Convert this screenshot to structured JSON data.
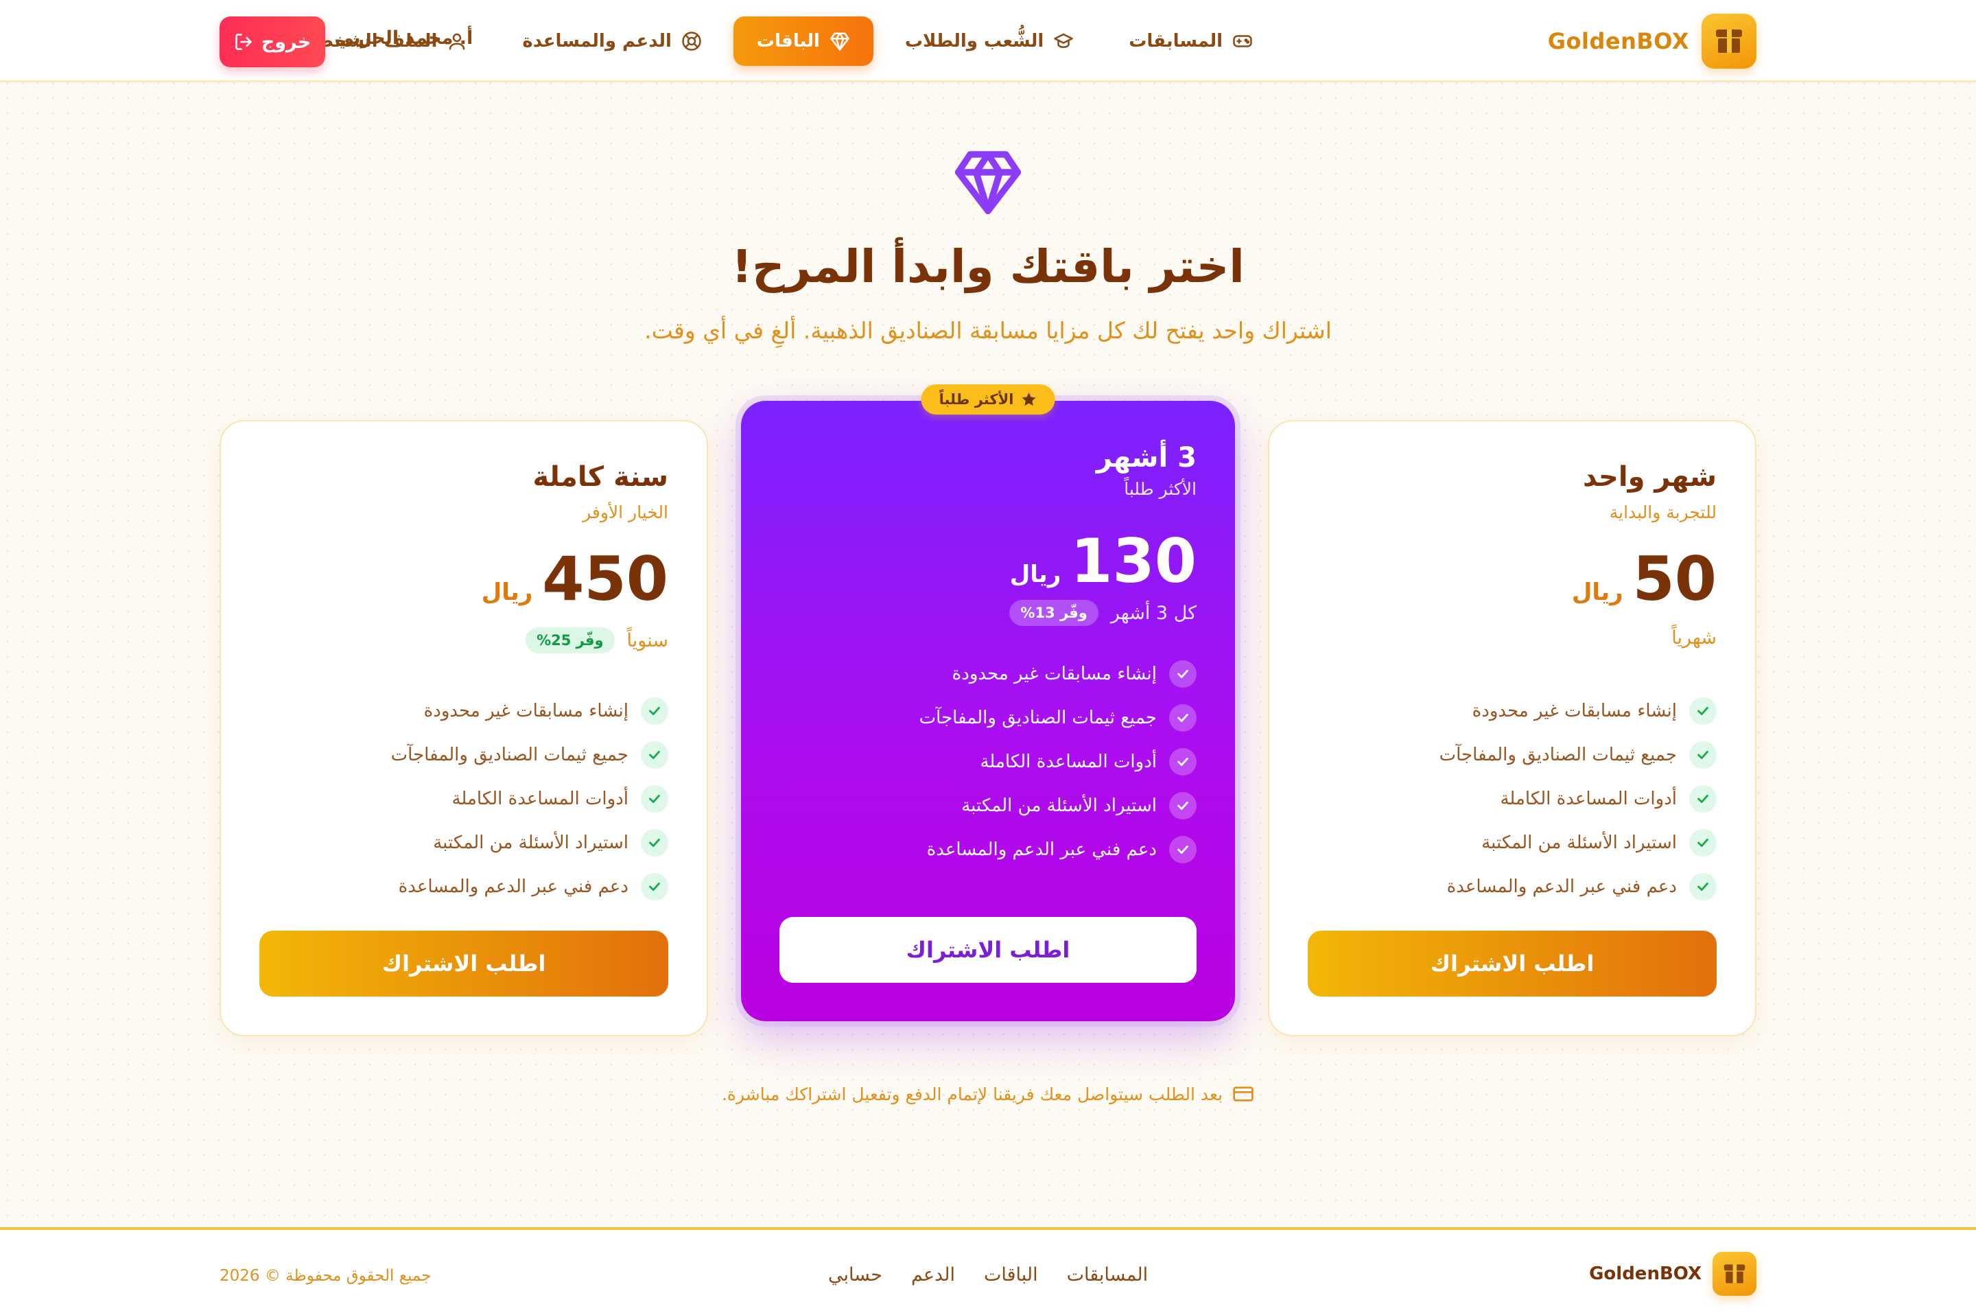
{
  "nav": {
    "brand": "GoldenBOX",
    "items": [
      {
        "label": "المسابقات",
        "icon": "gamepad-icon"
      },
      {
        "label": "الشُّعب والطلاب",
        "icon": "graduation-cap-icon"
      },
      {
        "label": "الباقات",
        "icon": "diamond-icon"
      },
      {
        "label": "الدعم والمساعدة",
        "icon": "lifebuoy-icon"
      },
      {
        "label": "الملف الشخصي",
        "icon": "user-icon"
      }
    ],
    "active_item": "الباقات",
    "user_name": "أ. محمد الحربي",
    "logout_label": "خروج"
  },
  "hero": {
    "icon": "diamond-icon",
    "title": "اختر باقتك وابدأ المرح!",
    "subtitle": "اشتراك واحد يفتح لك كل مزايا مسابقة الصناديق الذهبية. ألغِ في أي وقت."
  },
  "plans": [
    {
      "name": "شهر واحد",
      "tagline": "للتجربة والبداية",
      "price": "50",
      "currency": "ريال",
      "period": "شهرياً",
      "features": [
        "إنشاء مسابقات غير محدودة",
        "جميع ثيمات الصناديق والمفاجآت",
        "أدوات المساعدة الكاملة",
        "استيراد الأسئلة من المكتبة",
        "دعم فني عبر الدعم والمساعدة"
      ],
      "cta": "اطلب الاشتراك"
    },
    {
      "name": "3 أشهر",
      "tagline": "الأكثر طلباً",
      "price": "130",
      "currency": "ريال",
      "period": "كل 3 أشهر",
      "save": "وفّر 13%",
      "badge": "الأكثر طلباً",
      "features": [
        "إنشاء مسابقات غير محدودة",
        "جميع ثيمات الصناديق والمفاجآت",
        "أدوات المساعدة الكاملة",
        "استيراد الأسئلة من المكتبة",
        "دعم فني عبر الدعم والمساعدة"
      ],
      "cta": "اطلب الاشتراك"
    },
    {
      "name": "سنة كاملة",
      "tagline": "الخيار الأوفر",
      "price": "450",
      "currency": "ريال",
      "period": "سنوياً",
      "save": "وفّر 25%",
      "features": [
        "إنشاء مسابقات غير محدودة",
        "جميع ثيمات الصناديق والمفاجآت",
        "أدوات المساعدة الكاملة",
        "استيراد الأسئلة من المكتبة",
        "دعم فني عبر الدعم والمساعدة"
      ],
      "cta": "اطلب الاشتراك"
    }
  ],
  "note": {
    "icon": "credit-card-icon",
    "text": "بعد الطلب سيتواصل معك فريقنا لإتمام الدفع وتفعيل اشتراكك مباشرة."
  },
  "footer": {
    "brand": "GoldenBOX",
    "links": [
      "المسابقات",
      "الباقات",
      "الدعم",
      "حسابي"
    ],
    "copyright": "جميع الحقوق محفوظة © 2026"
  },
  "colors": {
    "brand_orange": "#f49a0c",
    "featured_purple": "#8b1cf7",
    "logout_red": "#ff2d55",
    "check_green": "#129a45"
  }
}
